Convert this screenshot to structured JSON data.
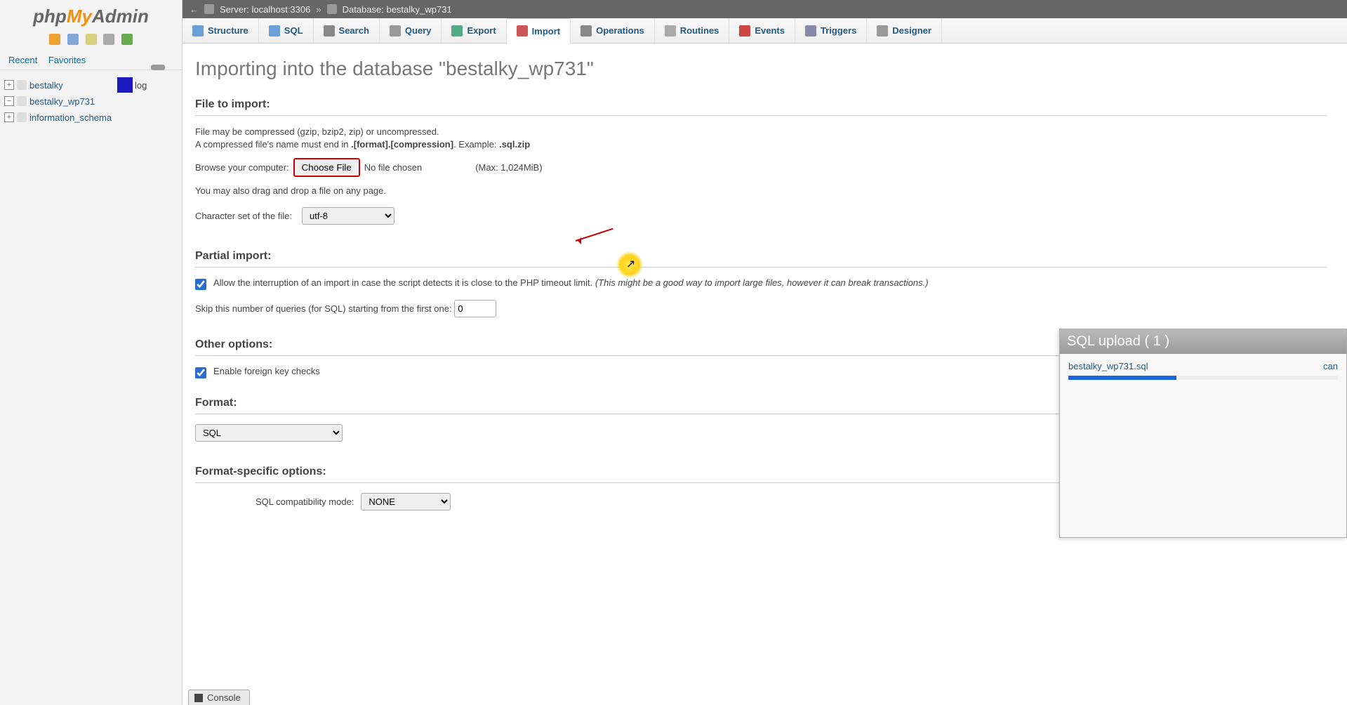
{
  "logo": {
    "p1": "php",
    "p2": "My",
    "p3": "Admin"
  },
  "sidebar": {
    "recent": "Recent",
    "favorites": "Favorites",
    "items": [
      {
        "name": "bestalky",
        "log": "log"
      },
      {
        "name": "bestalky_wp731"
      },
      {
        "name": "information_schema"
      }
    ]
  },
  "breadcrumb": {
    "server_label": "Server: localhost:3306",
    "db_label": "Database: bestalky_wp731"
  },
  "tabs": {
    "structure": "Structure",
    "sql": "SQL",
    "search": "Search",
    "query": "Query",
    "export": "Export",
    "import": "Import",
    "operations": "Operations",
    "routines": "Routines",
    "events": "Events",
    "triggers": "Triggers",
    "designer": "Designer"
  },
  "page": {
    "title": "Importing into the database \"bestalky_wp731\""
  },
  "file_section": {
    "heading": "File to import:",
    "help1": "File may be compressed (gzip, bzip2, zip) or uncompressed.",
    "help2a": "A compressed file's name must end in ",
    "help2b": ".[format].[compression]",
    "help2c": ". Example: ",
    "help2d": ".sql.zip",
    "browse_label": "Browse your computer:",
    "choose_btn": "Choose File",
    "no_file": "No file chosen",
    "max": "(Max: 1,024MiB)",
    "drag_note": "You may also drag and drop a file on any page.",
    "charset_label": "Character set of the file:",
    "charset_value": "utf-8"
  },
  "partial": {
    "heading": "Partial import:",
    "allow_text": "Allow the interruption of an import in case the script detects it is close to the PHP timeout limit. ",
    "allow_note": "(This might be a good way to import large files, however it can break transactions.)",
    "skip_label": "Skip this number of queries (for SQL) starting from the first one:",
    "skip_value": "0"
  },
  "other": {
    "heading": "Other options:",
    "fk_label": "Enable foreign key checks"
  },
  "format": {
    "heading": "Format:",
    "value": "SQL"
  },
  "format_spec": {
    "heading": "Format-specific options:",
    "compat_label": "SQL compatibility mode:",
    "compat_value": "NONE"
  },
  "upload": {
    "title": "SQL upload ( 1 )",
    "filename": "bestalky_wp731.sql",
    "cancel": "can"
  },
  "console": {
    "label": "Console"
  }
}
